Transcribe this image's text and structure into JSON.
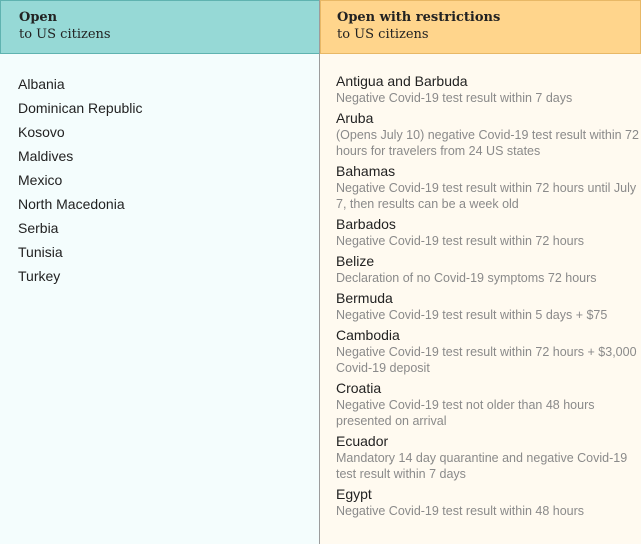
{
  "open": {
    "title": "Open",
    "subtitle": "to US citizens",
    "countries": [
      "Albania",
      "Dominican Republic",
      "Kosovo",
      "Maldives",
      "Mexico",
      "North Macedonia",
      "Serbia",
      "Tunisia",
      "Turkey"
    ]
  },
  "restricted": {
    "title": "Open with restrictions",
    "subtitle": "to US citizens",
    "countries": [
      {
        "name": "Antigua and Barbuda",
        "note": "Negative Covid-19 test result within 7 days"
      },
      {
        "name": "Aruba",
        "note": "(Opens July 10) negative Covid-19 test result within 72 hours for travelers from 24 US states"
      },
      {
        "name": "Bahamas",
        "note": "Negative Covid-19 test result within 72 hours until July 7, then results can be a week old"
      },
      {
        "name": "Barbados",
        "note": "Negative Covid-19 test result within 72 hours"
      },
      {
        "name": "Belize",
        "note": "Declaration of no Covid-19 symptoms 72 hours"
      },
      {
        "name": "Bermuda",
        "note": "Negative Covid-19 test result within 5 days + $75"
      },
      {
        "name": "Cambodia",
        "note": "Negative Covid-19 test result within 72 hours + $3,000 Covid-19 deposit"
      },
      {
        "name": "Croatia",
        "note": "Negative Covid-19 test not older than 48 hours presented on arrival"
      },
      {
        "name": "Ecuador",
        "note": "Mandatory 14 day quarantine and negative Covid-19 test result within 7 days"
      },
      {
        "name": "Egypt",
        "note": "Negative Covid-19 test result within 48 hours"
      }
    ]
  },
  "colors": {
    "open_header": "#96d9d6",
    "restricted_header": "#ffd58c",
    "note_text": "#8a8a8a"
  }
}
